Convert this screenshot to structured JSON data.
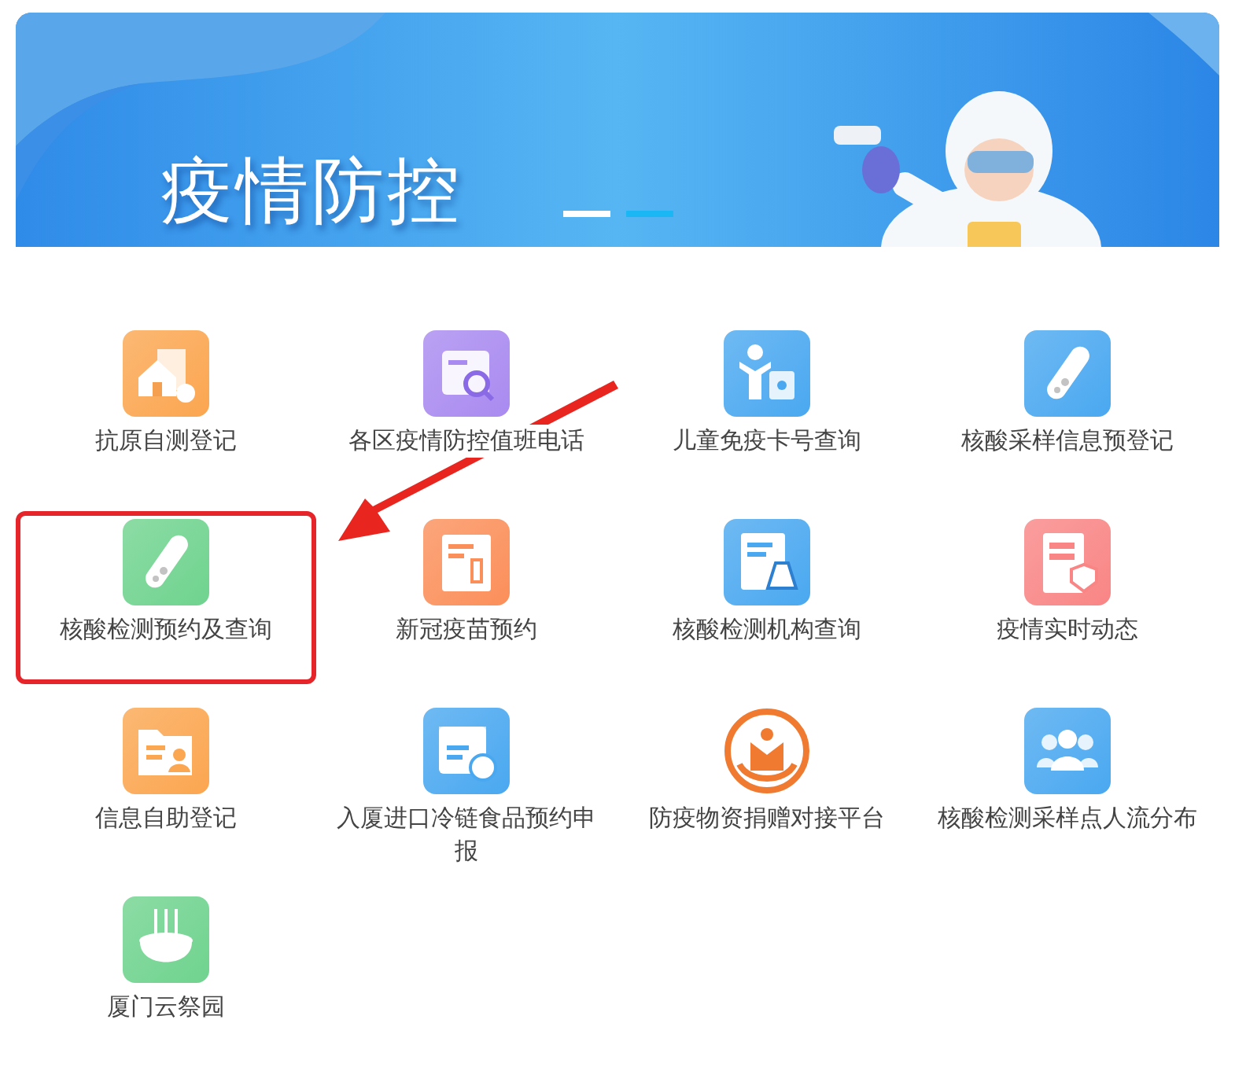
{
  "banner": {
    "title": "疫情防控"
  },
  "services": [
    {
      "label": "抗原自测登记",
      "kind": "house",
      "color": "#fba650",
      "highlighted": false
    },
    {
      "label": "各区疫情防控值班电话",
      "kind": "search-doc",
      "color": "#a98af0",
      "highlighted": false
    },
    {
      "label": "儿童免疫卡号查询",
      "kind": "child",
      "color": "#4aa8f0",
      "highlighted": false
    },
    {
      "label": "核酸采样信息预登记",
      "kind": "tube",
      "color": "#4aa8f0",
      "highlighted": false
    },
    {
      "label": "核酸检测预约及查询",
      "kind": "tube",
      "color": "#6fd38e",
      "highlighted": true
    },
    {
      "label": "新冠疫苗预约",
      "kind": "syringe-doc",
      "color": "#fb8f5a",
      "highlighted": false
    },
    {
      "label": "核酸检测机构查询",
      "kind": "flask-doc",
      "color": "#4aa8f0",
      "highlighted": false
    },
    {
      "label": "疫情实时动态",
      "kind": "shield-doc",
      "color": "#f98585",
      "highlighted": false
    },
    {
      "label": "信息自助登记",
      "kind": "folder-person",
      "color": "#fba650",
      "highlighted": false
    },
    {
      "label": "入厦进口冷链食品预约申报",
      "kind": "calendar-snow",
      "color": "#4aa8f0",
      "highlighted": false
    },
    {
      "label": "防疫物资捐赠对接平台",
      "kind": "emblem",
      "color": "#f07a30",
      "highlighted": false
    },
    {
      "label": "核酸检测采样点人流分布",
      "kind": "people",
      "color": "#4aa8f0",
      "highlighted": false
    },
    {
      "label": "厦门云祭园",
      "kind": "pot",
      "color": "#6fd38e",
      "highlighted": false
    }
  ]
}
